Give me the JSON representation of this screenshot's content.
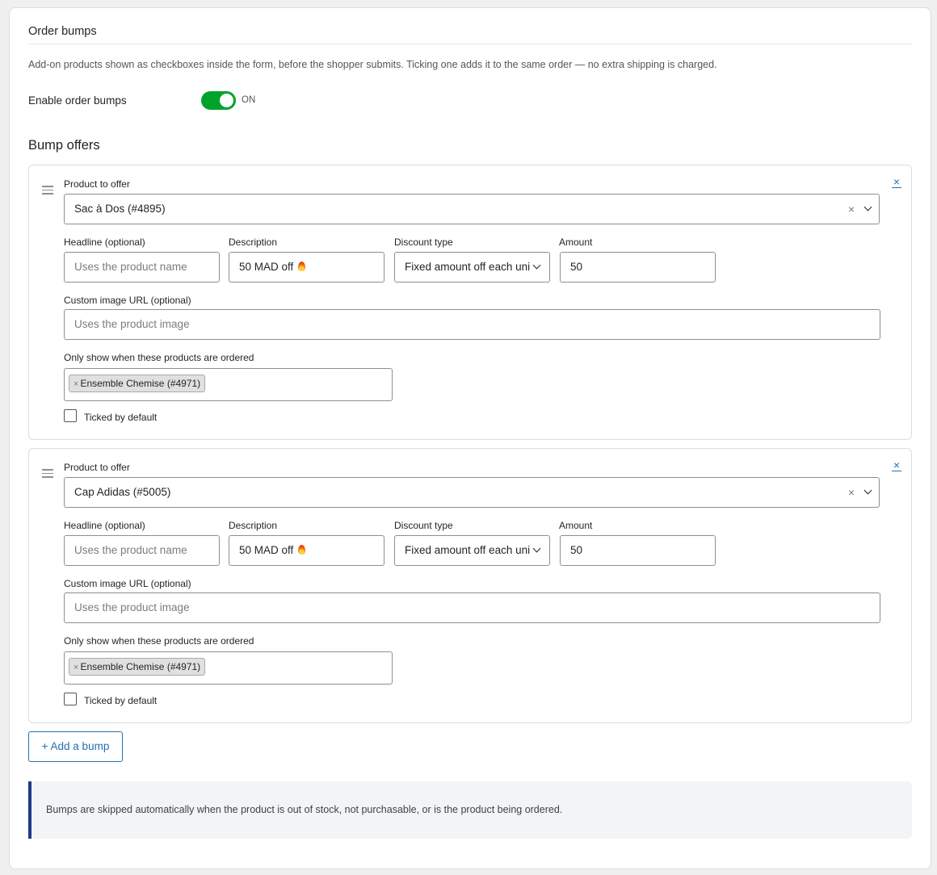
{
  "section": {
    "title": "Order bumps",
    "intro": "Add-on products shown as checkboxes inside the form, before the shopper submits. Ticking one adds it to the same order — no extra shipping is charged."
  },
  "enable": {
    "label": "Enable order bumps",
    "state": "ON",
    "checked": true
  },
  "offers_title": "Bump offers",
  "labels": {
    "product": "Product to offer",
    "headline": "Headline (optional)",
    "description": "Description",
    "discount_type": "Discount type",
    "amount": "Amount",
    "image": "Custom image URL (optional)",
    "only_show": "Only show when these products are ordered",
    "ticked": "Ticked by default"
  },
  "bumps": [
    {
      "product": "Sac à Dos (#4895)",
      "headline_placeholder": "Uses the product name",
      "headline_value": "",
      "description": "50 MAD off",
      "discount_type": "Fixed amount off each uni",
      "amount": "50",
      "image_placeholder": "Uses the product image",
      "trigger_products": [
        "Ensemble Chemise (#4971)"
      ],
      "ticked": false
    },
    {
      "product": "Cap Adidas (#5005)",
      "headline_placeholder": "Uses the product name",
      "headline_value": "",
      "description": "50 MAD off",
      "discount_type": "Fixed amount off each uni",
      "amount": "50",
      "image_placeholder": "Uses the product image",
      "trigger_products": [
        "Ensemble Chemise (#4971)"
      ],
      "ticked": false
    }
  ],
  "add_button": "+ Add a bump",
  "notice": "Bumps are skipped automatically when the product is out of stock, not purchasable, or is the product being ordered.",
  "icons": {
    "drag": "drag-handle-icon",
    "remove": "close-icon",
    "clear": "clear-icon",
    "chevron": "chevron-down-icon",
    "flame": "fire-emoji-icon"
  },
  "colors": {
    "toggle_on": "#00a32a",
    "link": "#2271b1",
    "notice_bar": "#1e3a8a"
  }
}
